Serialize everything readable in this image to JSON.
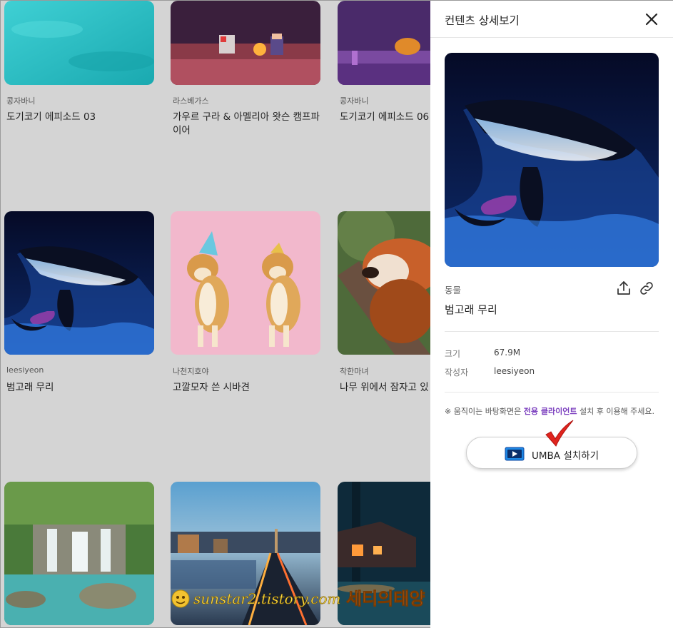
{
  "grid": {
    "cards": [
      {
        "category": "콩자바니",
        "title": "도기코기 에피소드 03"
      },
      {
        "category": "라스베가스",
        "title": "가우르 구라 & 아멜리아 왓슨 캠프파이어"
      },
      {
        "category": "콩자바니",
        "title": "도기코기 에피소드 06"
      },
      {
        "category": "leesiyeon",
        "title": "범고래 무리"
      },
      {
        "category": "나천지호야",
        "title": "고깔모자 쓴 시바견"
      },
      {
        "category": "착한마녀",
        "title": "나무 위에서 잠자고 있"
      }
    ]
  },
  "panel": {
    "title": "컨텐츠 상세보기",
    "category": "동물",
    "content_title": "범고래 무리",
    "size_label": "크기",
    "size_value": "67.9M",
    "author_label": "작성자",
    "author_value": "leesiyeon",
    "notice_prefix": "※ 움직이는 바탕화면은 ",
    "notice_highlight": "전용 클라이언트",
    "notice_suffix": " 설치 후 이용해 주세요.",
    "install_label": "UMBA 설치하기"
  },
  "colors": {
    "highlight": "#7b3fbf",
    "check": "#e0241e"
  },
  "icons": {
    "close": "close-icon",
    "share": "share-icon",
    "link": "link-icon",
    "install": "umba-app-icon",
    "annotation": "red-checkmark-icon"
  },
  "watermark": {
    "text": "sunstar2.tistory.com",
    "brand": "세티의태양"
  }
}
